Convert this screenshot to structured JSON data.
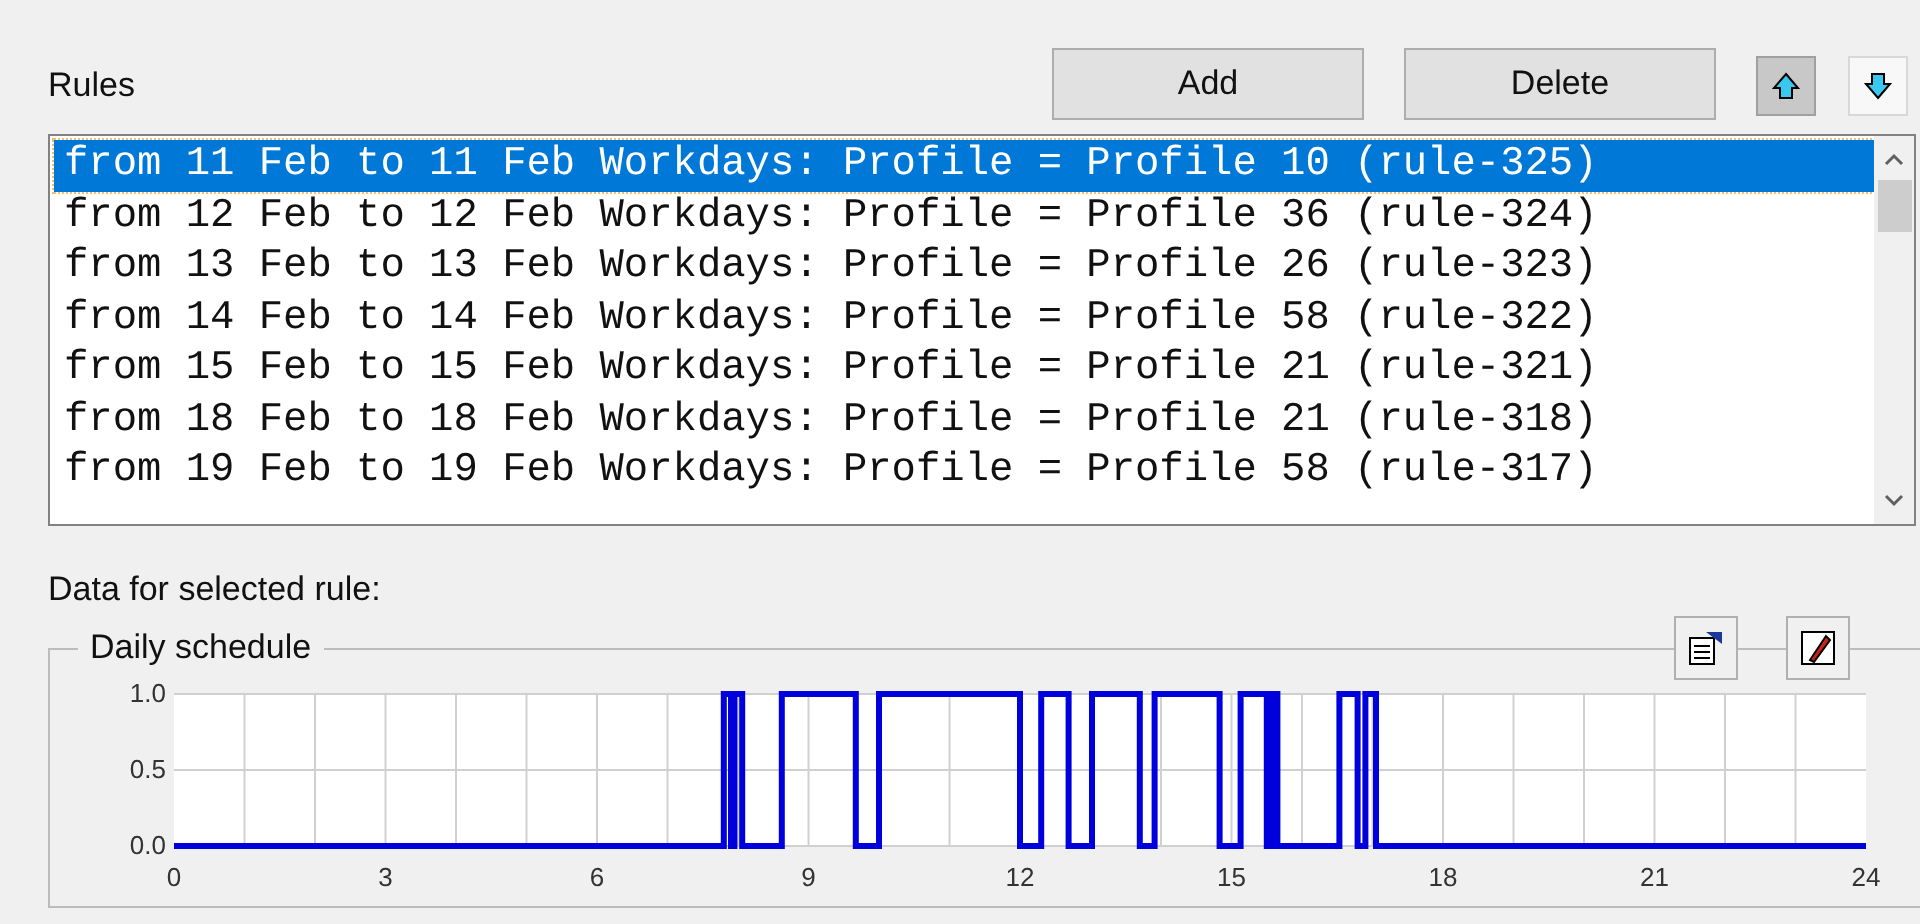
{
  "rules_panel": {
    "label": "Rules",
    "buttons": [
      "Add",
      "Delete"
    ],
    "move_buttons": [
      {
        "kind": "up",
        "pressed": true
      },
      {
        "kind": "down",
        "pressed": false
      }
    ],
    "rules": [
      {
        "text": "from 11 Feb to 11 Feb Workdays: Profile = Profile 10 (rule-325)",
        "selected": true
      },
      {
        "text": "from 12 Feb to 12 Feb Workdays: Profile = Profile 36 (rule-324)",
        "selected": false
      },
      {
        "text": "from 13 Feb to 13 Feb Workdays: Profile = Profile 26 (rule-323)",
        "selected": false
      },
      {
        "text": "from 14 Feb to 14 Feb Workdays: Profile = Profile 58 (rule-322)",
        "selected": false
      },
      {
        "text": "from 15 Feb to 15 Feb Workdays: Profile = Profile 21 (rule-321)",
        "selected": false
      },
      {
        "text": "from 18 Feb to 18 Feb Workdays: Profile = Profile 21 (rule-318)",
        "selected": false
      },
      {
        "text": "from 19 Feb to 19 Feb Workdays: Profile = Profile 58 (rule-317)",
        "selected": false
      }
    ]
  },
  "selected_rule": {
    "label": "Data for selected rule:",
    "group_title": "Daily schedule",
    "chart_data": {
      "type": "line",
      "x": [
        0,
        7.8,
        7.8,
        7.9,
        7.9,
        7.95,
        7.95,
        8.06,
        8.06,
        8.62,
        8.62,
        9.67,
        9.67,
        10.0,
        10.0,
        12.0,
        12.0,
        12.3,
        12.3,
        12.69,
        12.69,
        13.02,
        13.02,
        13.7,
        13.7,
        13.91,
        13.91,
        14.83,
        14.83,
        15.13,
        15.13,
        15.5,
        15.5,
        15.58,
        15.58,
        15.65,
        15.65,
        16.53,
        16.53,
        16.79,
        16.79,
        16.9,
        16.9,
        17.05,
        17.05,
        24
      ],
      "grid": true,
      "series": [
        {
          "color": "#0000dd",
          "values": [
            0,
            0,
            1,
            1,
            0,
            0,
            1,
            1,
            0,
            0,
            1,
            1,
            0,
            0,
            1,
            1,
            0,
            0,
            1,
            1,
            0,
            0,
            1,
            1,
            0,
            0,
            1,
            1,
            0,
            0,
            1,
            1,
            0,
            0,
            1,
            1,
            0,
            0,
            1,
            1,
            0,
            0,
            1,
            1,
            0,
            0
          ]
        }
      ],
      "xlim": [
        0,
        24
      ],
      "ylim": [
        0,
        1
      ],
      "xticks": [
        0,
        3,
        6,
        9,
        12,
        15,
        18,
        21,
        24
      ],
      "yticks": [
        {
          "value": 0,
          "label": "0.0"
        },
        {
          "value": 0.5,
          "label": "0.5"
        },
        {
          "value": 1,
          "label": "1.0"
        }
      ]
    }
  }
}
